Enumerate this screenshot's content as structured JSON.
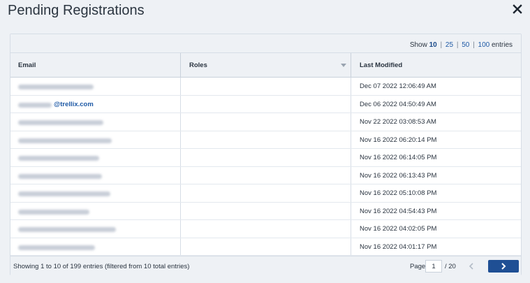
{
  "dialog": {
    "title": "Pending Registrations",
    "close_icon": "close-icon"
  },
  "show_entries": {
    "prefix": "Show",
    "options": [
      "10",
      "25",
      "50",
      "100"
    ],
    "selected": "10",
    "suffix": "entries"
  },
  "table": {
    "columns": [
      "Email",
      "Roles",
      "Last Modified"
    ],
    "rows": [
      {
        "email_visible": "",
        "roles": "",
        "last_modified": "Dec 07 2022 12:06:49 AM"
      },
      {
        "email_visible": "@trellix.com",
        "roles": "",
        "last_modified": "Dec 06 2022 04:50:49 AM"
      },
      {
        "email_visible": "",
        "roles": "",
        "last_modified": "Nov 22 2022 03:08:53 AM"
      },
      {
        "email_visible": "",
        "roles": "",
        "last_modified": "Nov 16 2022 06:20:14 PM"
      },
      {
        "email_visible": "",
        "roles": "",
        "last_modified": "Nov 16 2022 06:14:05 PM"
      },
      {
        "email_visible": "",
        "roles": "",
        "last_modified": "Nov 16 2022 06:13:43 PM"
      },
      {
        "email_visible": "",
        "roles": "",
        "last_modified": "Nov 16 2022 05:10:08 PM"
      },
      {
        "email_visible": "",
        "roles": "",
        "last_modified": "Nov 16 2022 04:54:43 PM"
      },
      {
        "email_visible": "",
        "roles": "",
        "last_modified": "Nov 16 2022 04:02:05 PM"
      },
      {
        "email_visible": "",
        "roles": "",
        "last_modified": "Nov 16 2022 04:01:17 PM"
      }
    ]
  },
  "footer": {
    "summary": "Showing 1 to 10 of 199 entries (filtered from 10 total entries)",
    "page_label": "Page",
    "page_value": "1",
    "page_total": "/ 20"
  },
  "colors": {
    "accent": "#1f4f94",
    "link": "#1f5aa6",
    "header_bg": "#eef1f5"
  }
}
